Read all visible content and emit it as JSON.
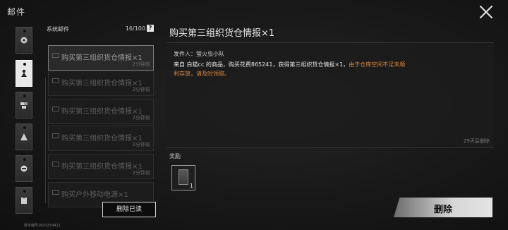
{
  "header": {
    "title": "邮件"
  },
  "list": {
    "category": "系统邮件",
    "count": "16/100",
    "help": "?",
    "items": [
      {
        "subject": "购买第三组织货仓情报×1",
        "time": "2分钟前"
      },
      {
        "subject": "购买第三组织货仓情报×1",
        "time": "2分钟前"
      },
      {
        "subject": "购买第三组织货仓情报×1",
        "time": "2分钟前"
      },
      {
        "subject": "购买第三组织货仓情报×1",
        "time": "2分钟前"
      },
      {
        "subject": "购买第三组织货仓情报×1",
        "time": "2分钟前"
      },
      {
        "subject": "购买户外移动电源×1",
        "time": ""
      }
    ],
    "delete_read": "删除已读",
    "uid": "数字编号2603254411"
  },
  "detail": {
    "title": "购买第三组织货仓情报×1",
    "sender": "发件人：萤火虫小队",
    "body": "来自 白猫cc 的商品，购买花费865241，获得第三组织货仓情报×1，",
    "warning": "由于仓库空间不足未顺利存放，请及时领取。",
    "expire": "29天后删除",
    "reward_label": "奖励",
    "reward_qty": "1",
    "delete": "删除"
  },
  "colors": {
    "warning": "#d9863c",
    "accent": "#e4e4e4"
  }
}
